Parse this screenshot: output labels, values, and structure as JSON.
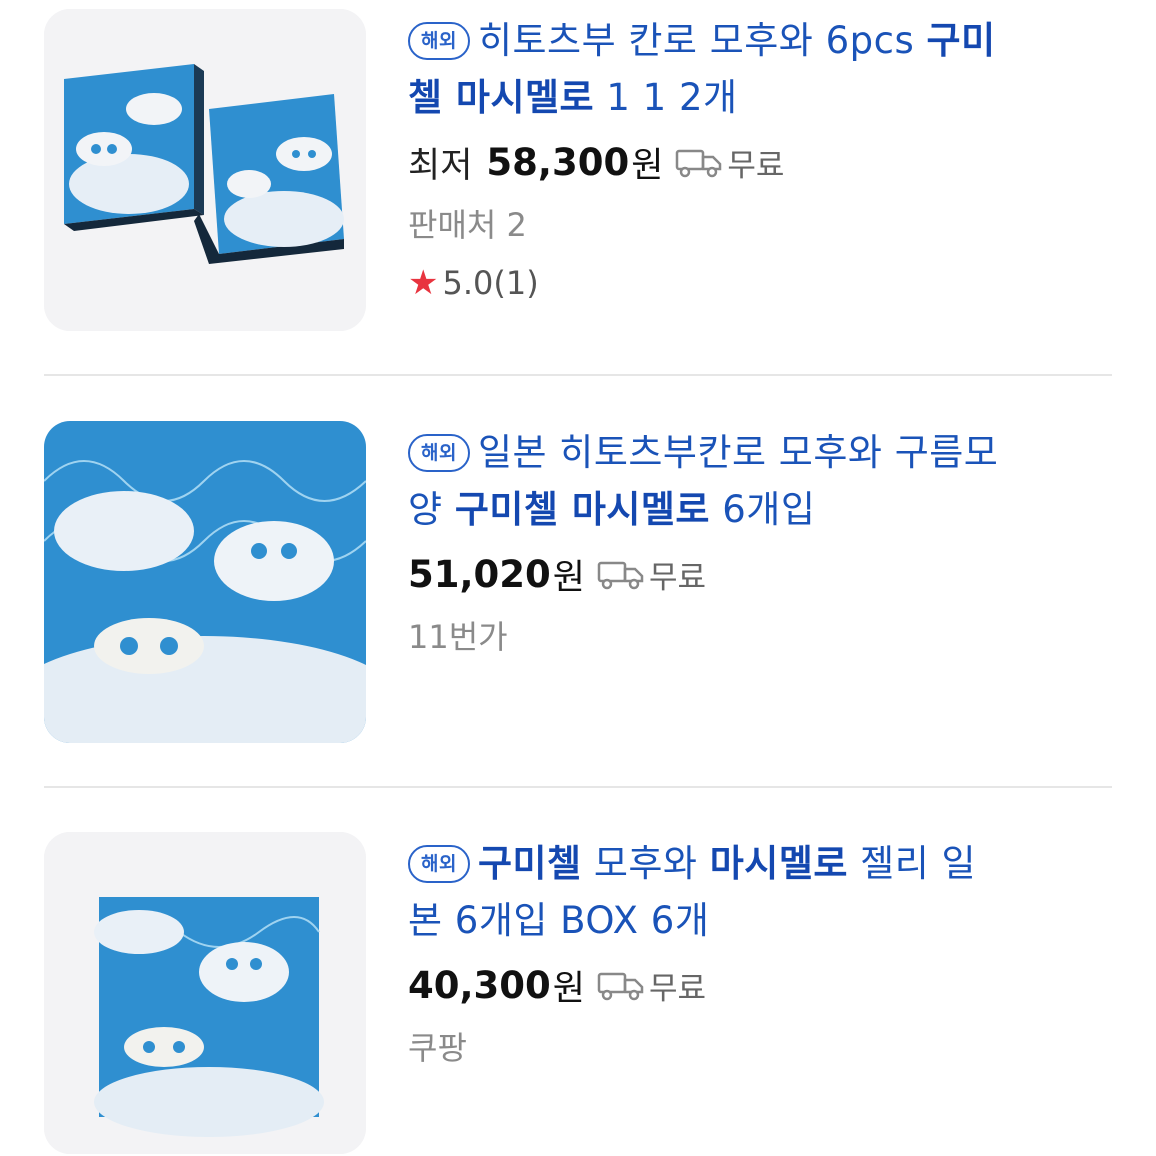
{
  "items": [
    {
      "badge": "해외",
      "title_parts": [
        {
          "text": "히토츠부 칸로 모후와 6pcs ",
          "bold": false
        },
        {
          "text": "구미\n첼 마시멜로",
          "bold": true
        },
        {
          "text": " 1 1 2개",
          "bold": false
        }
      ],
      "price_label": "최저",
      "price": "58,300",
      "price_unit": "원",
      "shipping": "무료",
      "seller": "판매처 2",
      "rating": "5.0(1)"
    },
    {
      "badge": "해외",
      "title_parts": [
        {
          "text": "일본 히토츠부칸로 모후와 구름모\n양 ",
          "bold": false
        },
        {
          "text": "구미첼 마시멜로",
          "bold": true
        },
        {
          "text": " 6개입",
          "bold": false
        }
      ],
      "price_label": "",
      "price": "51,020",
      "price_unit": "원",
      "shipping": "무료",
      "seller": "11번가",
      "rating": ""
    },
    {
      "badge": "해외",
      "title_parts": [
        {
          "text": "구미첼",
          "bold": true
        },
        {
          "text": " 모후와 ",
          "bold": false
        },
        {
          "text": "마시멜로",
          "bold": true
        },
        {
          "text": " 젤리 일\n본 6개입 BOX 6개",
          "bold": false
        }
      ],
      "price_label": "",
      "price": "40,300",
      "price_unit": "원",
      "shipping": "무료",
      "seller": "쿠팡",
      "rating": ""
    }
  ],
  "icons": {
    "truck": "truck-icon",
    "star": "star-icon"
  },
  "colors": {
    "title": "#1a53b8",
    "badge": "#2a63c9",
    "star": "#e8343f",
    "box_blue": "#2f8fd0"
  }
}
